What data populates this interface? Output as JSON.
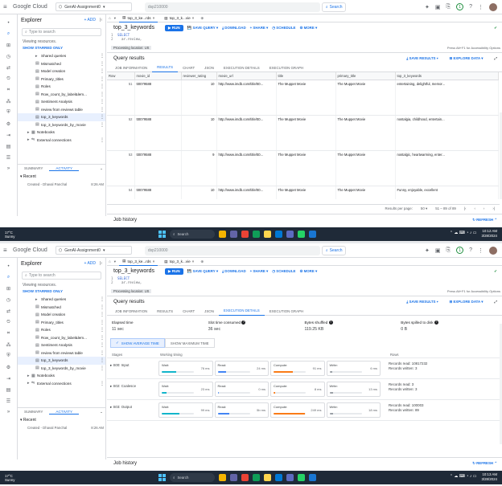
{
  "topbar": {
    "logo_google": "Google",
    "logo_cloud": "Cloud",
    "project": "GenAI-Assignment0",
    "search_value": "dsp210000",
    "search_button": "Search"
  },
  "explorer": {
    "title": "Explorer",
    "add_label": "+ ADD",
    "search_placeholder": "Type to search",
    "viewing": "Viewing resources.",
    "show_starred": "SHOW STARRED ONLY",
    "items": [
      {
        "label": "Shared queries",
        "icon": "folder"
      },
      {
        "label": "Mismatched",
        "icon": "query"
      },
      {
        "label": "Model creation",
        "icon": "query"
      },
      {
        "label": "Primary_titles",
        "icon": "query"
      },
      {
        "label": "Roles",
        "icon": "query"
      },
      {
        "label": "Row_count_by_label&lem...",
        "icon": "query"
      },
      {
        "label": "Sentiment Analysis",
        "icon": "query"
      },
      {
        "label": "review from reviews table",
        "icon": "query"
      },
      {
        "label": "top_3_keywords",
        "icon": "query"
      },
      {
        "label": "top_3_keywords_by_movie",
        "icon": "query"
      }
    ],
    "notebooks": "Notebooks",
    "external": "External connections",
    "tab_summary": "SUMMARY",
    "tab_activity": "ACTIVITY",
    "recent": "Recent",
    "recent_item": "Created - Dhaval Panchal",
    "recent_time_a": "8:26 AM",
    "recent_time_b": "8:26 AM"
  },
  "tabs": {
    "tab1": "top_3_ke...rds",
    "tab2": "top_3_k...vie"
  },
  "query": {
    "name": "top_3_keywords",
    "run": "RUN",
    "save_query": "SAVE QUERY",
    "download": "DOWNLOAD",
    "share": "SHARE",
    "schedule": "SCHEDULE",
    "more": "MORE",
    "line1": "SELECT",
    "line2": "ar.review,",
    "processing": "Processing location: US",
    "accessibility": "Press Alt+F1 for Accessibility Options"
  },
  "results": {
    "title": "Query results",
    "save_results": "SAVE RESULTS",
    "explore_data": "EXPLORE DATA",
    "tabs": [
      "JOB INFORMATION",
      "RESULTS",
      "CHART",
      "JSON",
      "EXECUTION DETAILS",
      "EXECUTION GRAPH"
    ],
    "columns": [
      "Row",
      "movie_id",
      "reviewer_rating",
      "movie_url",
      "title",
      "primary_title",
      "top_3_keywords"
    ],
    "rows": [
      [
        "51",
        "tt0079588",
        "10",
        "http://www.imdb.com/title/tt0...",
        "The Muppet Movie",
        "The Muppet Movie",
        "entertaining, delightful, memor..."
      ],
      [
        "52",
        "tt0079588",
        "10",
        "http://www.imdb.com/title/tt0...",
        "The Muppet Movie",
        "The Muppet Movie",
        "nostalgia, childhood, entertain..."
      ],
      [
        "53",
        "tt0079588",
        "9",
        "http://www.imdb.com/title/tt0...",
        "The Muppet Movie",
        "The Muppet Movie",
        "nostalgic, heartwarming, enter..."
      ],
      [
        "54",
        "tt0079588",
        "10",
        "http://www.imdb.com/title/tt0...",
        "The Muppet Movie",
        "The Muppet Movie",
        "Funny, enjoyable, excellent"
      ]
    ],
    "pager_label": "Results per page:",
    "pager_size": "50",
    "pager_range": "51 – 89 of 89"
  },
  "exec": {
    "elapsed_label": "Elapsed time",
    "elapsed_val": "11 sec",
    "slot_label": "Slot time consumed",
    "slot_val": "36 sec",
    "shuffled_label": "Bytes shuffled",
    "shuffled_val": "119.25 KB",
    "spilled_label": "Bytes spilled to disk",
    "spilled_val": "0 B",
    "show_avg": "SHOW AVERAGE TIME",
    "show_max": "SHOW MAXIMUM TIME",
    "col_stages": "Stages",
    "col_timing": "Working timing",
    "col_rows": "Rows",
    "stages": [
      {
        "name": "S00: Input",
        "wait": "76 ms",
        "read": "24 ms",
        "compute": "91 ms",
        "write": "6 ms",
        "rows_read": "Records read: 10817232",
        "rows_written": "Records written: 3",
        "fills": [
          0.45,
          0.25,
          0.6,
          0.08
        ]
      },
      {
        "name": "S02: Coalesce",
        "wait": "23 ms",
        "read": "0 ms",
        "compute": "8 ms",
        "write": "13 ms",
        "rows_read": "Records read: 3",
        "rows_written": "Records written: 3",
        "fills": [
          0.15,
          0.02,
          0.05,
          0.1
        ]
      },
      {
        "name": "S03: Output",
        "wait": "99 ms",
        "read": "5b ms",
        "compute": "249 ms",
        "write": "18 ms",
        "rows_read": "Records read: 100003",
        "rows_written": "Records written: 89",
        "fills": [
          0.55,
          0.35,
          0.98,
          0.12
        ]
      }
    ],
    "lbl_wait": "Wait:",
    "lbl_read": "Read:",
    "lbl_compute": "Compute:",
    "lbl_write": "Write:"
  },
  "jobhistory": {
    "title": "Job history",
    "refresh": "REFRESH"
  },
  "taskbar": {
    "temp": "17°C",
    "cond": "Sunny",
    "search": "Search",
    "time_a": "10:12 AM",
    "date_a": "3/28/2024",
    "time_b": "10:13 AM",
    "date_b": "3/28/2024"
  },
  "colors": {
    "accent": "#1a73e8",
    "taskbar": "#1f2a38",
    "bar_wait": "#12b5cb",
    "bar_read": "#4285f4",
    "bar_compute": "#fa7b17",
    "bar_write": "#9aa0a6"
  }
}
